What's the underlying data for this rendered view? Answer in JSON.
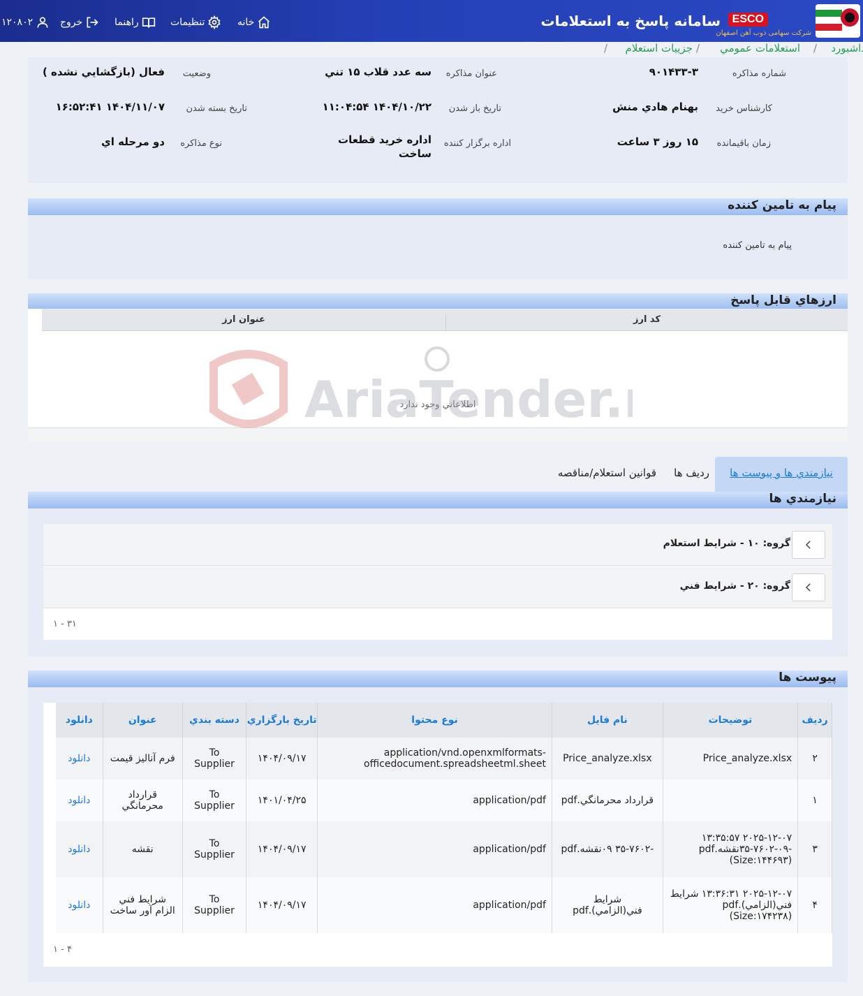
{
  "header": {
    "app_title": "سامانه پاسخ به استعلامات",
    "brand": "ESCO",
    "brand_subtitle": "شرکت سهامی ذوب آهن اصفهان",
    "nav": {
      "home": "خانه",
      "settings": "تنظيمات",
      "help": "راهنما",
      "logout": "خروج",
      "user_code": "۱۲۰۸۰۲"
    }
  },
  "breadcrumb": {
    "dashboard": "داشبورد",
    "public": "استعلامات عمومي",
    "details": "جزييات استعلام"
  },
  "info": {
    "negotiation_number_label": "شماره مذاكره",
    "negotiation_number": "۹۰۱۴۳۳-۳",
    "negotiation_title_label": "عنوان مذاكره",
    "negotiation_title": "سه عدد قلاب ۱۵ تني",
    "status_label": "وضعيت",
    "status": "فعال (بازگشايي نشده )",
    "purchase_expert_label": "كارشناس خريد",
    "purchase_expert": "بهنام هادي منش",
    "opening_date_label": "تاريخ باز شدن",
    "opening_date": "۱۴۰۴/۱۰/۲۲ ۱۱:۰۴:۵۴",
    "closing_date_label": "تاريخ بسته شدن",
    "closing_date": "۱۴۰۴/۱۱/۰۷ ۱۶:۵۲:۴۱",
    "remaining_label": "زمان باقيمانده",
    "remaining": "۱۵ روز ۳ ساعت",
    "organizer_label": "اداره برگزار كننده",
    "organizer": "اداره خريد قطعات ساخت",
    "negotiation_type_label": "نوع مذاكره",
    "negotiation_type": "دو مرحله اي"
  },
  "supplier_message": {
    "title": "پيام به تامين كننده",
    "text": "پيام به تامين كننده"
  },
  "currencies": {
    "title": "ارزهاي قابل پاسخ",
    "columns": [
      "كد ارز",
      "عنوان ارز"
    ],
    "empty_text": "اطلاعاتي وجود ندارد"
  },
  "watermark": {
    "text": "AriaTender.neT"
  },
  "tabs": {
    "requirements": "نيازمندي ها و پيوست ها",
    "rows": "رديف ها",
    "rules": "قوانين استعلام/مناقصه"
  },
  "requirements": {
    "title": "نيازمندي ها",
    "groups": [
      {
        "label": "گروه: ۱۰ - شرايط استعلام"
      },
      {
        "label": "گروه: ۲۰ - شرايط فني"
      }
    ],
    "pager": "۱ - ۳۱"
  },
  "attachments": {
    "title": "پيوست ها",
    "columns": {
      "row": "رديف",
      "description": "توضيحات",
      "file_name": "نام فايل",
      "content_type": "نوع محتوا",
      "upload_date": "تاريخ بارگزاري",
      "category": "دسته بندي",
      "title": "عنوان",
      "download": "دانلود"
    },
    "rows": [
      {
        "row": "۲",
        "description": "Price_analyze.xlsx",
        "file_name": "Price_analyze.xlsx",
        "content_type": "application/vnd.openxmlformats-officedocument.spreadsheetml.sheet",
        "upload_date": "۱۴۰۴/۰۹/۱۷",
        "category": "To Supplier",
        "title": "فرم آناليز قيمت",
        "download": "دانلود"
      },
      {
        "row": "۱",
        "description": "",
        "file_name": "قرارداد محرمانگي.pdf",
        "content_type": "application/pdf",
        "upload_date": "۱۴۰۱/۰۴/۲۵",
        "category": "To Supplier",
        "title": "قرارداد محرمانگي",
        "download": "دانلود"
      },
      {
        "row": "۳",
        "description": "۲۰۲۵-۱۲-۰۷ ۱۳:۳۵:۵۷ -۳۵-۷۶۰۲-۰۹نقشه.pdf (Size:۱۴۴۶۹۳)",
        "file_name": "-۳۵-۷۶۰۲ ۰۹نقشه.pdf",
        "content_type": "application/pdf",
        "upload_date": "۱۴۰۴/۰۹/۱۷",
        "category": "To Supplier",
        "title": "نقشه",
        "download": "دانلود"
      },
      {
        "row": "۴",
        "description": "۲۰۲۵-۱۲-۰۷ ۱۳:۳۶:۳۱ شرايط فني(الزامي).pdf (Size:۱۷۴۲۳۸)",
        "file_name": "شرايط فني(الزامي).pdf",
        "content_type": "application/pdf",
        "upload_date": "۱۴۰۴/۰۹/۱۷",
        "category": "To Supplier",
        "title": "شرايط فني الزام آور ساخت",
        "download": "دانلود"
      }
    ],
    "pager": "۱ - ۴"
  },
  "colors": {
    "topbar": "#2440b5",
    "breadcrumb": "#2a9c54",
    "link": "#1a7bd8",
    "panel_bg": "#e6ebf5",
    "header_band": "#9bbcf0"
  }
}
